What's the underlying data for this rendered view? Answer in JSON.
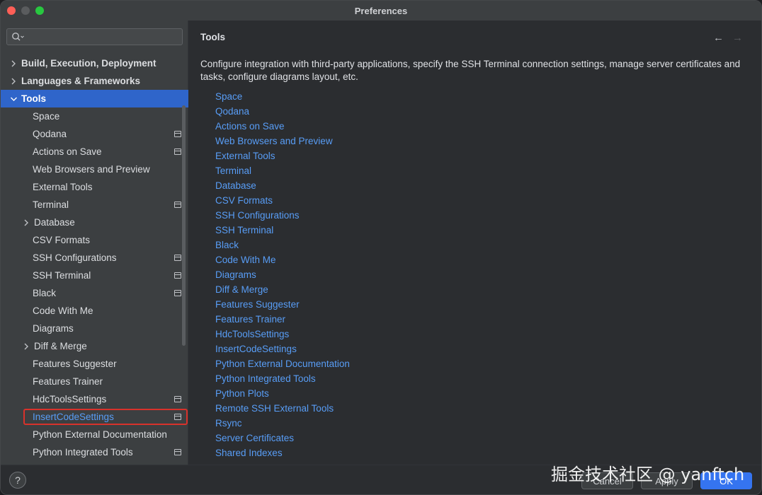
{
  "window": {
    "title": "Preferences"
  },
  "search": {
    "placeholder": "",
    "value": ""
  },
  "sidebar": {
    "categories": [
      {
        "label": "Build, Execution, Deployment"
      },
      {
        "label": "Languages & Frameworks"
      },
      {
        "label": "Tools"
      }
    ],
    "tools_items": [
      {
        "label": "Space"
      },
      {
        "label": "Qodana"
      },
      {
        "label": "Actions on Save"
      },
      {
        "label": "Web Browsers and Preview"
      },
      {
        "label": "External Tools"
      },
      {
        "label": "Terminal"
      },
      {
        "label": "Database"
      },
      {
        "label": "CSV Formats"
      },
      {
        "label": "SSH Configurations"
      },
      {
        "label": "SSH Terminal"
      },
      {
        "label": "Black"
      },
      {
        "label": "Code With Me"
      },
      {
        "label": "Diagrams"
      },
      {
        "label": "Diff & Merge"
      },
      {
        "label": "Features Suggester"
      },
      {
        "label": "Features Trainer"
      },
      {
        "label": "HdcToolsSettings"
      },
      {
        "label": "InsertCodeSettings"
      },
      {
        "label": "Python External Documentation"
      },
      {
        "label": "Python Integrated Tools"
      }
    ]
  },
  "content": {
    "title": "Tools",
    "description": "Configure integration with third-party applications, specify the SSH Terminal connection settings, manage server certificates and tasks, configure diagrams layout, etc.",
    "links": [
      "Space",
      "Qodana",
      "Actions on Save",
      "Web Browsers and Preview",
      "External Tools",
      "Terminal",
      "Database",
      "CSV Formats",
      "SSH Configurations",
      "SSH Terminal",
      "Black",
      "Code With Me",
      "Diagrams",
      "Diff & Merge",
      "Features Suggester",
      "Features Trainer",
      "HdcToolsSettings",
      "InsertCodeSettings",
      "Python External Documentation",
      "Python Integrated Tools",
      "Python Plots",
      "Remote SSH External Tools",
      "Rsync",
      "Server Certificates",
      "Shared Indexes"
    ],
    "back_icon": "arrow-left-icon",
    "forward_icon": "arrow-right-icon"
  },
  "footer": {
    "help_label": "?",
    "cancel_label": "Cancel",
    "apply_label": "Apply",
    "ok_label": "OK"
  },
  "watermark": "掘金技术社区 @ yanftch",
  "colors": {
    "selection": "#2f65ca",
    "link": "#589df6",
    "highlight_box": "#d8322b",
    "ok_button": "#3574f0"
  }
}
